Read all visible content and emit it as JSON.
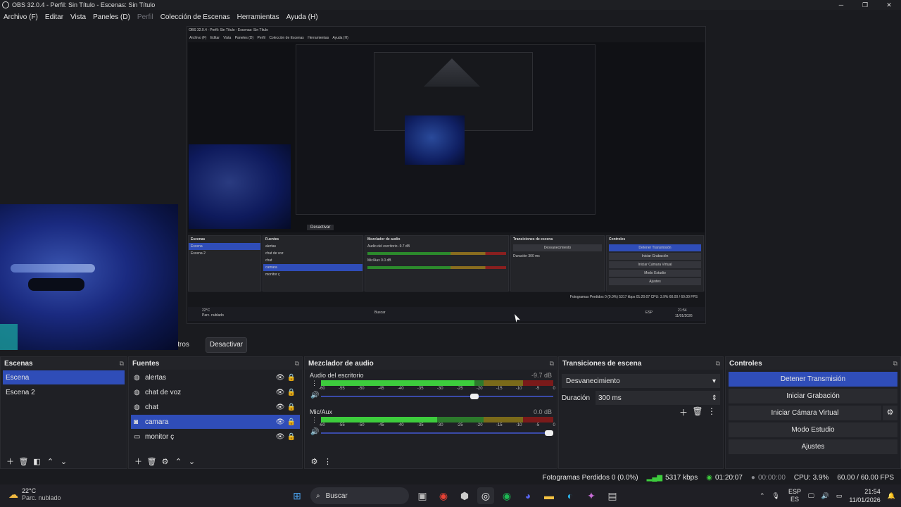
{
  "window": {
    "title": "OBS 32.0.4 - Perfil: Sin Título - Escenas: Sin Título",
    "minimize": "─",
    "maximize": "❐",
    "close": "✕"
  },
  "menu": [
    "Archivo (F)",
    "Editar",
    "Vista",
    "Paneles (D)",
    "Perfil",
    "Colección de Escenas",
    "Herramientas",
    "Ayuda (H)"
  ],
  "nested_preview": {
    "title": "OBS 32.0.4 - Perfil: Sin Título - Escenas: Sin Título",
    "menu": [
      "Archivo (F)",
      "Editar",
      "Vista",
      "Paneles (D)",
      "Perfil",
      "Colección de Escenas",
      "Herramientas",
      "Ayuda (H)"
    ],
    "deactivate": "Desactivar",
    "filters_partial": "ltros",
    "panels": {
      "scenes": "Escenas",
      "sources": "Fuentes",
      "mixer": "Mezclador de audio",
      "transitions": "Transiciones de escena",
      "controls": "Controles"
    },
    "scene_items": [
      "Escena",
      "Escena 2"
    ],
    "source_items": [
      "alertas",
      "chat de voz",
      "chat",
      "camara",
      "monitor ç"
    ],
    "mixer_desktop": "Audio del escritorio",
    "mixer_mic": "Mic/Aux",
    "mixer_desktop_db": "-9.7 dB",
    "mixer_mic_db": "0.0 dB",
    "transition_select": "Desvanecimiento",
    "duration_label": "Duración",
    "duration_value": "300 ms",
    "controls": [
      "Detener Transmisión",
      "Iniciar Grabación",
      "Iniciar Cámara Virtual",
      "Modo Estudio",
      "Ajustes"
    ],
    "status": "Fotogramas Perdidos 0 (0.0%)   5317 kbps   01:20:07   CPU: 3.9%   60.00 / 60.00 FPS",
    "taskbar_temp": "22°C",
    "taskbar_weather": "Parc. nublado",
    "taskbar_search": "Buscar",
    "taskbar_lang": "ESP",
    "taskbar_time": "21:54",
    "taskbar_date": "11/01/2026"
  },
  "preview_buttons": {
    "filters_partial": "ltros",
    "deactivate": "Desactivar"
  },
  "scenes": {
    "header": "Escenas",
    "items": [
      "Escena",
      "Escena 2"
    ],
    "selected": "Escena"
  },
  "sources": {
    "header": "Fuentes",
    "items": [
      {
        "label": "alertas",
        "icon": "globe-icon"
      },
      {
        "label": "chat de voz",
        "icon": "globe-icon"
      },
      {
        "label": "chat",
        "icon": "globe-icon"
      },
      {
        "label": "camara",
        "icon": "camera-icon"
      },
      {
        "label": "monitor ç",
        "icon": "monitor-icon"
      }
    ],
    "selected": "camara"
  },
  "mixer": {
    "header": "Mezclador de audio",
    "channels": [
      {
        "name": "Audio del escritorio",
        "db": "-9.7 dB",
        "level": 0.66,
        "volume": 0.68
      },
      {
        "name": "Mic/Aux",
        "db": "0.0 dB",
        "level": 0.5,
        "volume": 1.0
      }
    ],
    "ticks": [
      "-60",
      "-55",
      "-50",
      "-45",
      "-40",
      "-35",
      "-30",
      "-25",
      "-20",
      "-15",
      "-10",
      "-5",
      "0"
    ]
  },
  "transitions": {
    "header": "Transiciones de escena",
    "selected": "Desvanecimiento",
    "duration_label": "Duración",
    "duration_value": "300 ms"
  },
  "controls": {
    "header": "Controles",
    "stop_stream": "Detener Transmisión",
    "start_recording": "Iniciar Grabación",
    "start_virtual_cam": "Iniciar Cámara Virtual",
    "studio_mode": "Modo Estudio",
    "settings": "Ajustes"
  },
  "status": {
    "dropped_frames": "Fotogramas Perdidos 0 (0.0%)",
    "bitrate": "5317 kbps",
    "stream_time": "01:20:07",
    "record_time": "00:00:00",
    "cpu": "CPU: 3.9%",
    "fps": "60.00 / 60.00 FPS"
  },
  "taskbar": {
    "temperature": "22°C",
    "weather": "Parc. nublado",
    "search": "Buscar",
    "lang_top": "ESP",
    "lang_bottom": "ES",
    "time": "21:54",
    "date": "11/01/2026"
  },
  "colors": {
    "accent": "#2f4db8",
    "background": "#1a1b1f",
    "panel": "#1f2025",
    "meter_green": "#3dcc3d"
  }
}
